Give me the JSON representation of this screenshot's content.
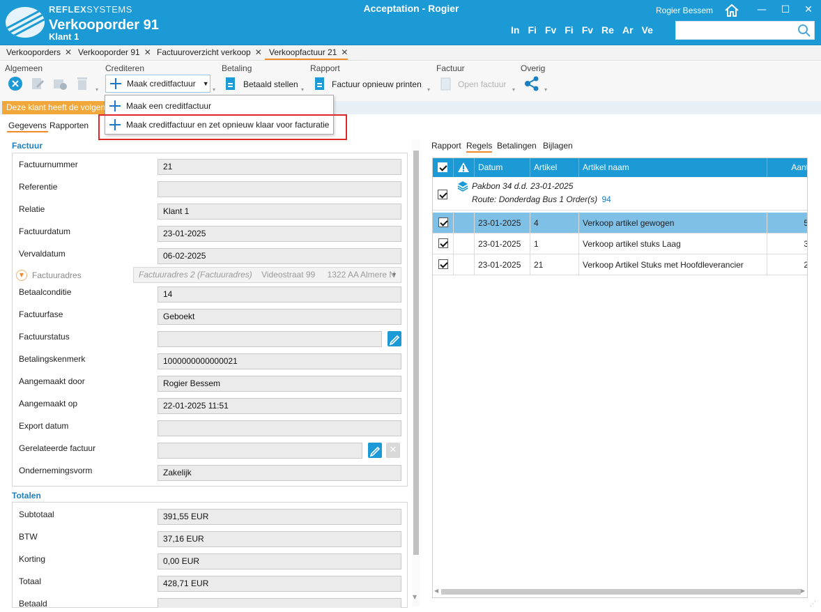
{
  "header": {
    "brand_bold": "REFLEX",
    "brand_thin": "SYSTEMS",
    "doc_title": "Verkooporder 91",
    "doc_sub": "Klant 1",
    "window_title": "Acceptation - Rogier",
    "user": "Rogier Bessem",
    "languages": [
      "In",
      "Fi",
      "Fv",
      "Fi",
      "Fv",
      "Re",
      "Ar",
      "Ve"
    ],
    "search_placeholder": "",
    "minimize": "—",
    "maximize": "☐",
    "close": "✕"
  },
  "tabs": [
    {
      "label": "Verkooporders",
      "active": false
    },
    {
      "label": "Verkooporder 91",
      "active": false
    },
    {
      "label": "Factuuroverzicht verkoop",
      "active": false
    },
    {
      "label": "Verkoopfactuur 21",
      "active": true
    }
  ],
  "ribbon": {
    "groups": [
      "Algemeen",
      "Crediteren",
      "Betaling",
      "Rapport",
      "Factuur",
      "Overig"
    ],
    "credit_button": "Maak creditfactuur",
    "paid_button": "Betaald stellen",
    "reprint_button": "Factuur opnieuw printen",
    "open_invoice_button": "Open factuur"
  },
  "dropdown": {
    "items": [
      "Maak een creditfactuur",
      "Maak creditfactuur en zet opnieuw klaar voor facturatie"
    ]
  },
  "info_warning": "Deze klant heeft de volgende",
  "left_tabs": [
    "Gegevens",
    "Rapporten"
  ],
  "factuur": {
    "title": "Factuur",
    "fields": [
      {
        "label": "Factuurnummer",
        "value": "21"
      },
      {
        "label": "Referentie",
        "value": ""
      },
      {
        "label": "Relatie",
        "value": "Klant 1"
      },
      {
        "label": "Factuurdatum",
        "value": "23-01-2025"
      },
      {
        "label": "Vervaldatum",
        "value": "06-02-2025"
      }
    ],
    "address_label": "Factuuradres",
    "address_value": "Factuuradres 2 (Factuuradres)",
    "address_street": "Videostraat 99",
    "address_city": "1322 AA  Almere  N",
    "fields2": [
      {
        "label": "Betaalconditie",
        "value": "14"
      },
      {
        "label": "Factuurfase",
        "value": "Geboekt"
      },
      {
        "label": "Factuurstatus",
        "value": ""
      },
      {
        "label": "Betalingskenmerk",
        "value": "1000000000000021"
      },
      {
        "label": "Aangemaakt door",
        "value": "Rogier Bessem"
      },
      {
        "label": "Aangemaakt op",
        "value": "22-01-2025 11:51"
      },
      {
        "label": "Export datum",
        "value": ""
      },
      {
        "label": "Gerelateerde factuur",
        "value": ""
      },
      {
        "label": "Ondernemingsvorm",
        "value": "Zakelijk"
      }
    ]
  },
  "totalen": {
    "title": "Totalen",
    "fields": [
      {
        "label": "Subtotaal",
        "value": "391,55 EUR"
      },
      {
        "label": "BTW",
        "value": "37,16 EUR"
      },
      {
        "label": "Korting",
        "value": "0,00 EUR"
      },
      {
        "label": "Totaal",
        "value": "428,71 EUR"
      },
      {
        "label": "Betaald",
        "value": ""
      }
    ]
  },
  "right_tabs": [
    "Rapport",
    "Regels",
    "Betalingen",
    "Bijlagen"
  ],
  "grid": {
    "columns": [
      "Datum",
      "Artikel",
      "Artikel naam",
      "Aant"
    ],
    "group": {
      "line1": "Pakbon 34  d.d.  23-01-2025",
      "line2": "Route:  Donderdag Bus 1 Order(s)",
      "order": "94"
    },
    "rows": [
      {
        "datum": "23-01-2025",
        "artikel": "4",
        "naam": "Verkoop artikel gewogen",
        "aantal": "5",
        "selected": true
      },
      {
        "datum": "23-01-2025",
        "artikel": "1",
        "naam": "Verkoop artikel stuks Laag",
        "aantal": "3",
        "selected": false
      },
      {
        "datum": "23-01-2025",
        "artikel": "21",
        "naam": "Verkoop Artikel Stuks met Hoofdleverancier",
        "aantal": "2",
        "selected": false
      }
    ]
  },
  "colors": {
    "header_blue": "#1b9ad6",
    "accent_orange": "#f08a24",
    "warning_orange": "#f2a73a",
    "highlight_red": "#e0262b",
    "section_blue": "#1b7fc1"
  }
}
